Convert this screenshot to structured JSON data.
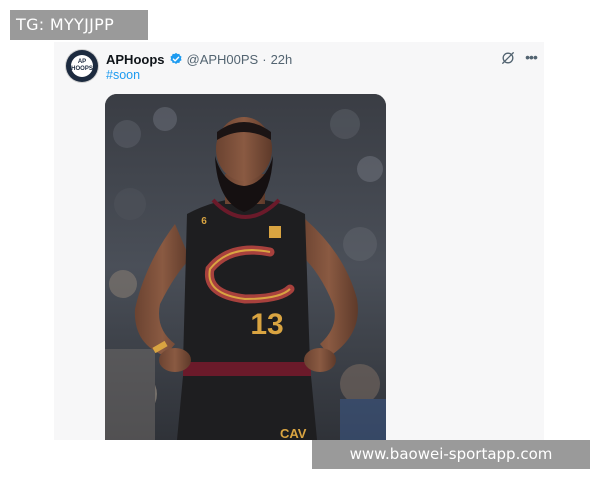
{
  "overlay": {
    "tg_text": "TG: MYYJJPP"
  },
  "tweet": {
    "avatar_text": [
      "AP",
      "HOOPS"
    ],
    "display_name": "APHoops",
    "handle": "@APH00PS",
    "separator": "·",
    "time": "22h",
    "hashtag": "#soon",
    "verified": true,
    "accent_color": "#1d9bf0",
    "image": {
      "jersey_number": "13",
      "collar_number": "6",
      "logo_letter": "C",
      "shorts_text": "CAV"
    }
  },
  "watermark": {
    "text": "www.baowei-sportapp.com"
  }
}
